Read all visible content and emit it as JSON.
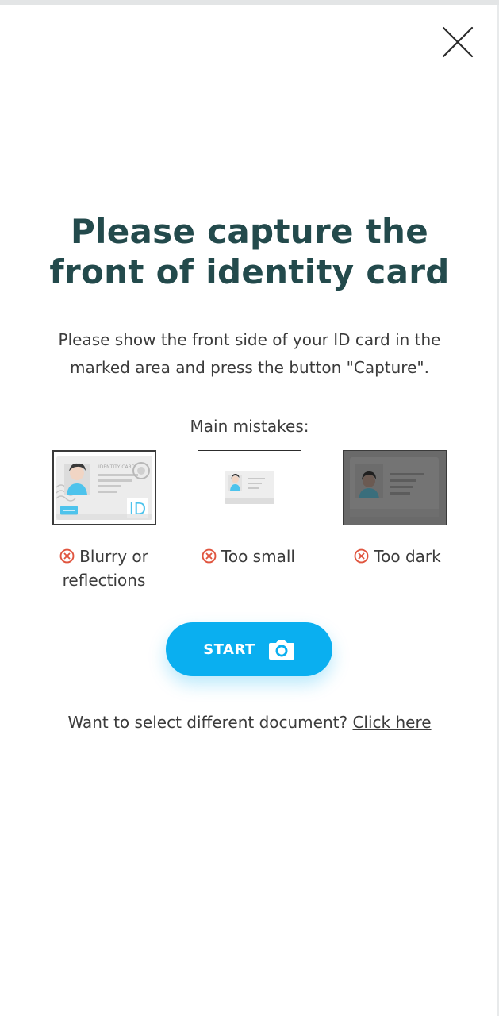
{
  "header": {
    "close_icon": "close-icon"
  },
  "main": {
    "title_line1": "Please capture the",
    "title_line2": "front of identity card",
    "instructions": "Please show the front side of your ID card in the marked area and press the button \"Capture\".",
    "mistakes_label": "Main mistakes:",
    "mistakes": [
      {
        "icon": "error-circle-icon",
        "label": "Blurry or reflections",
        "card_text": "IDENTITY CARD",
        "badge": "ID"
      },
      {
        "icon": "error-circle-icon",
        "label": "Too small"
      },
      {
        "icon": "error-circle-icon",
        "label": "Too dark"
      }
    ],
    "start_button": {
      "label": "START",
      "icon": "camera-icon"
    },
    "footer": {
      "prompt": "Want to select different document?",
      "link_label": "Click here"
    }
  },
  "colors": {
    "title": "#234a4c",
    "accent": "#0aaff0",
    "error": "#e0553f",
    "text": "#3b3b3b"
  }
}
